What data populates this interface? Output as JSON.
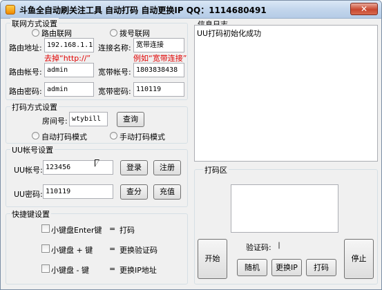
{
  "window": {
    "title": "斗鱼全自动刷关注工具 自动打码 自动更换IP    QQ：1114680491",
    "close_label": "✕"
  },
  "network": {
    "legend": "联网方式设置",
    "radio_router": "路由联网",
    "radio_dialup": "拨号联网",
    "router_addr_label": "路由地址:",
    "router_addr_value": "192.168.1.1",
    "router_hint": "去掉“http://”",
    "conn_name_label": "连接名称:",
    "conn_name_value": "宽带连接",
    "conn_hint": "例如“宽带连接”",
    "router_account_label": "路由帐号:",
    "router_account_value": "admin",
    "broadband_account_label": "宽带帐号:",
    "broadband_account_value": "1803838438",
    "router_pwd_label": "路由密码:",
    "router_pwd_value": "admin",
    "broadband_pwd_label": "宽带密码:",
    "broadband_pwd_value": "110119"
  },
  "captcha_mode": {
    "legend": "打码方式设置",
    "room_label": "房间号:",
    "room_value": "wtybill",
    "query_button": "查询",
    "auto_mode": "自动打码模式",
    "manual_mode": "手动打码模式"
  },
  "uu": {
    "legend": "UU帐号设置",
    "account_label": "UU帐号:",
    "account_value": "123456",
    "login_button": "登录",
    "register_button": "注册",
    "password_label": "UU密码:",
    "password_value": "110119",
    "check_balance_button": "查分",
    "recharge_button": "充值"
  },
  "hotkeys": {
    "legend": "快捷键设置",
    "items": [
      {
        "key": "小键盘Enter键",
        "action": "打码"
      },
      {
        "key": "小键盘 + 键",
        "action": "更换验证码"
      },
      {
        "key": "小键盘 - 键",
        "action": "更换IP地址"
      }
    ],
    "separator": "="
  },
  "log": {
    "legend": "信息日志",
    "lines": [
      "UU打码初始化成功"
    ]
  },
  "captcha_area": {
    "legend": "打码区",
    "captcha_label": "验证码:",
    "start_button": "开始",
    "random_button": "随机",
    "change_ip_button": "更换IP",
    "captcha_button": "打码",
    "stop_button": "停止"
  }
}
